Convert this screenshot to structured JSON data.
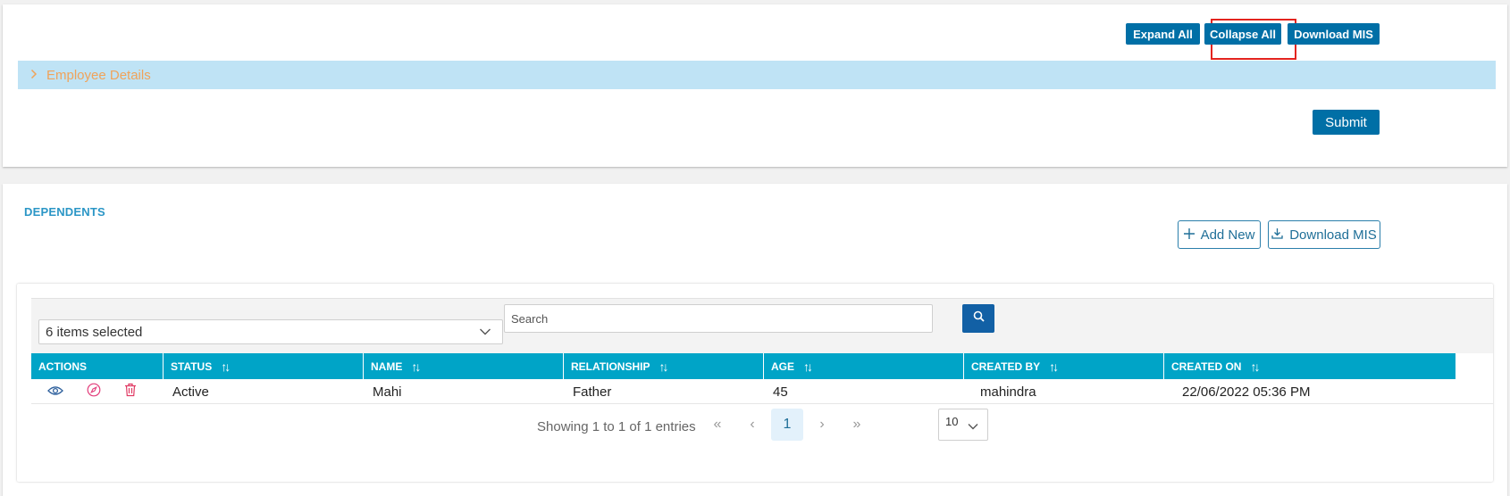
{
  "top_card": {
    "buttons": {
      "expand_all": "Expand All",
      "collapse_all": "Collapse All",
      "download_mis": "Download MIS",
      "submit": "Submit"
    },
    "accordion": {
      "label": "Employee Details",
      "icon": "chevron-right-icon",
      "expanded": false
    }
  },
  "dependents": {
    "title": "DEPENDENTS",
    "add_new": "Add New",
    "download_mis": "Download MIS",
    "filter": {
      "selected_text": "6 items selected"
    },
    "search": {
      "placeholder": "Search"
    },
    "table": {
      "columns": [
        "ACTIONS",
        "STATUS",
        "NAME",
        "RELATIONSHIP",
        "AGE",
        "CREATED BY",
        "CREATED ON"
      ],
      "rows": [
        {
          "status": "Active",
          "name": "Mahi",
          "relationship": "Father",
          "age": "45",
          "created_by": "mahindra",
          "created_on": "22/06/2022 05:36 PM"
        }
      ]
    },
    "pagination": {
      "info": "Showing 1 to 1 of 1 entries",
      "first": "«",
      "prev": "‹",
      "current_page": "1",
      "next": "›",
      "last": "»",
      "page_size": "10"
    }
  },
  "colors": {
    "primary": "#006fa6",
    "header": "#00a4c7",
    "accordion_bg": "#bfe3f5",
    "accordion_text": "#f0a35a",
    "highlight": "#e3241f"
  }
}
